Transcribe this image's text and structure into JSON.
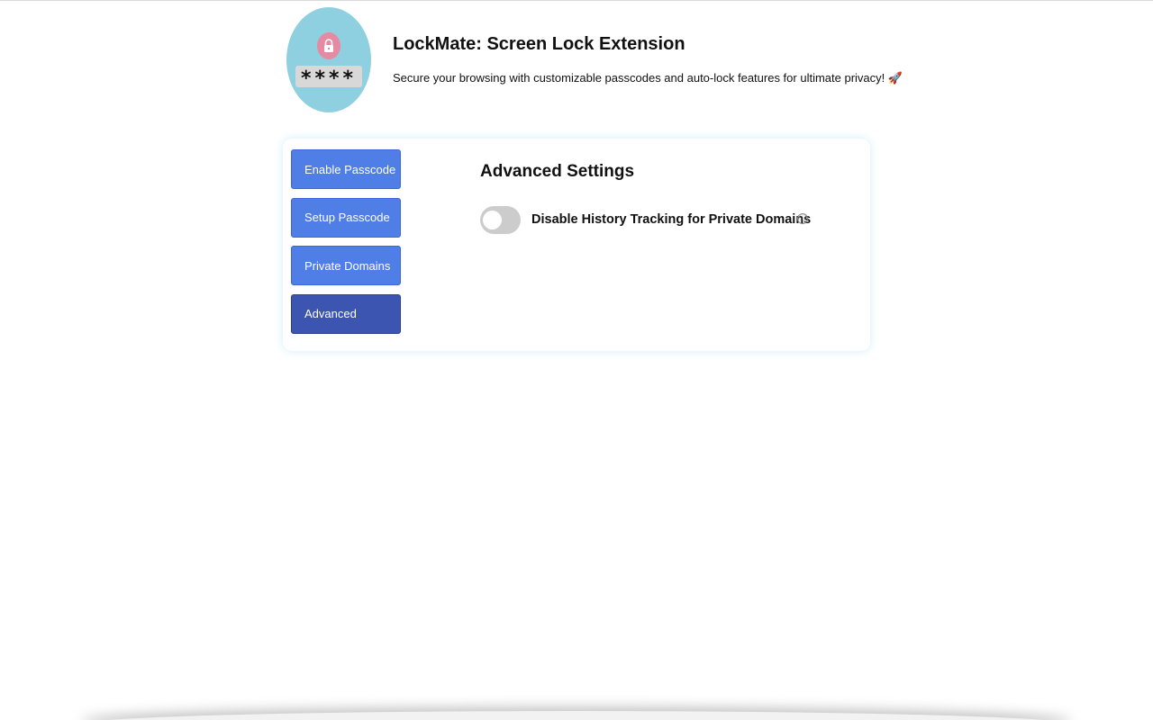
{
  "header": {
    "title": "LockMate: Screen Lock Extension",
    "subtitle": "Secure your browsing with customizable passcodes and auto-lock features for ultimate privacy! 🚀",
    "logo_stars": "****"
  },
  "sidebar": {
    "items": [
      {
        "label": "Enable Passcode",
        "active": false
      },
      {
        "label": "Setup Passcode",
        "active": false
      },
      {
        "label": "Private Domains",
        "active": false
      },
      {
        "label": "Advanced",
        "active": true
      }
    ]
  },
  "main": {
    "section_title": "Advanced Settings",
    "settings": [
      {
        "label": "Disable History Tracking for Private Domains",
        "enabled": false,
        "info_icon": "ⓘ"
      }
    ]
  },
  "colors": {
    "nav_button": "#4f7ee6",
    "nav_button_active": "#3b55b0",
    "logo_background": "#8fd0e0",
    "lock_badge": "#e58aa2",
    "toggle_off": "#cccccc"
  }
}
